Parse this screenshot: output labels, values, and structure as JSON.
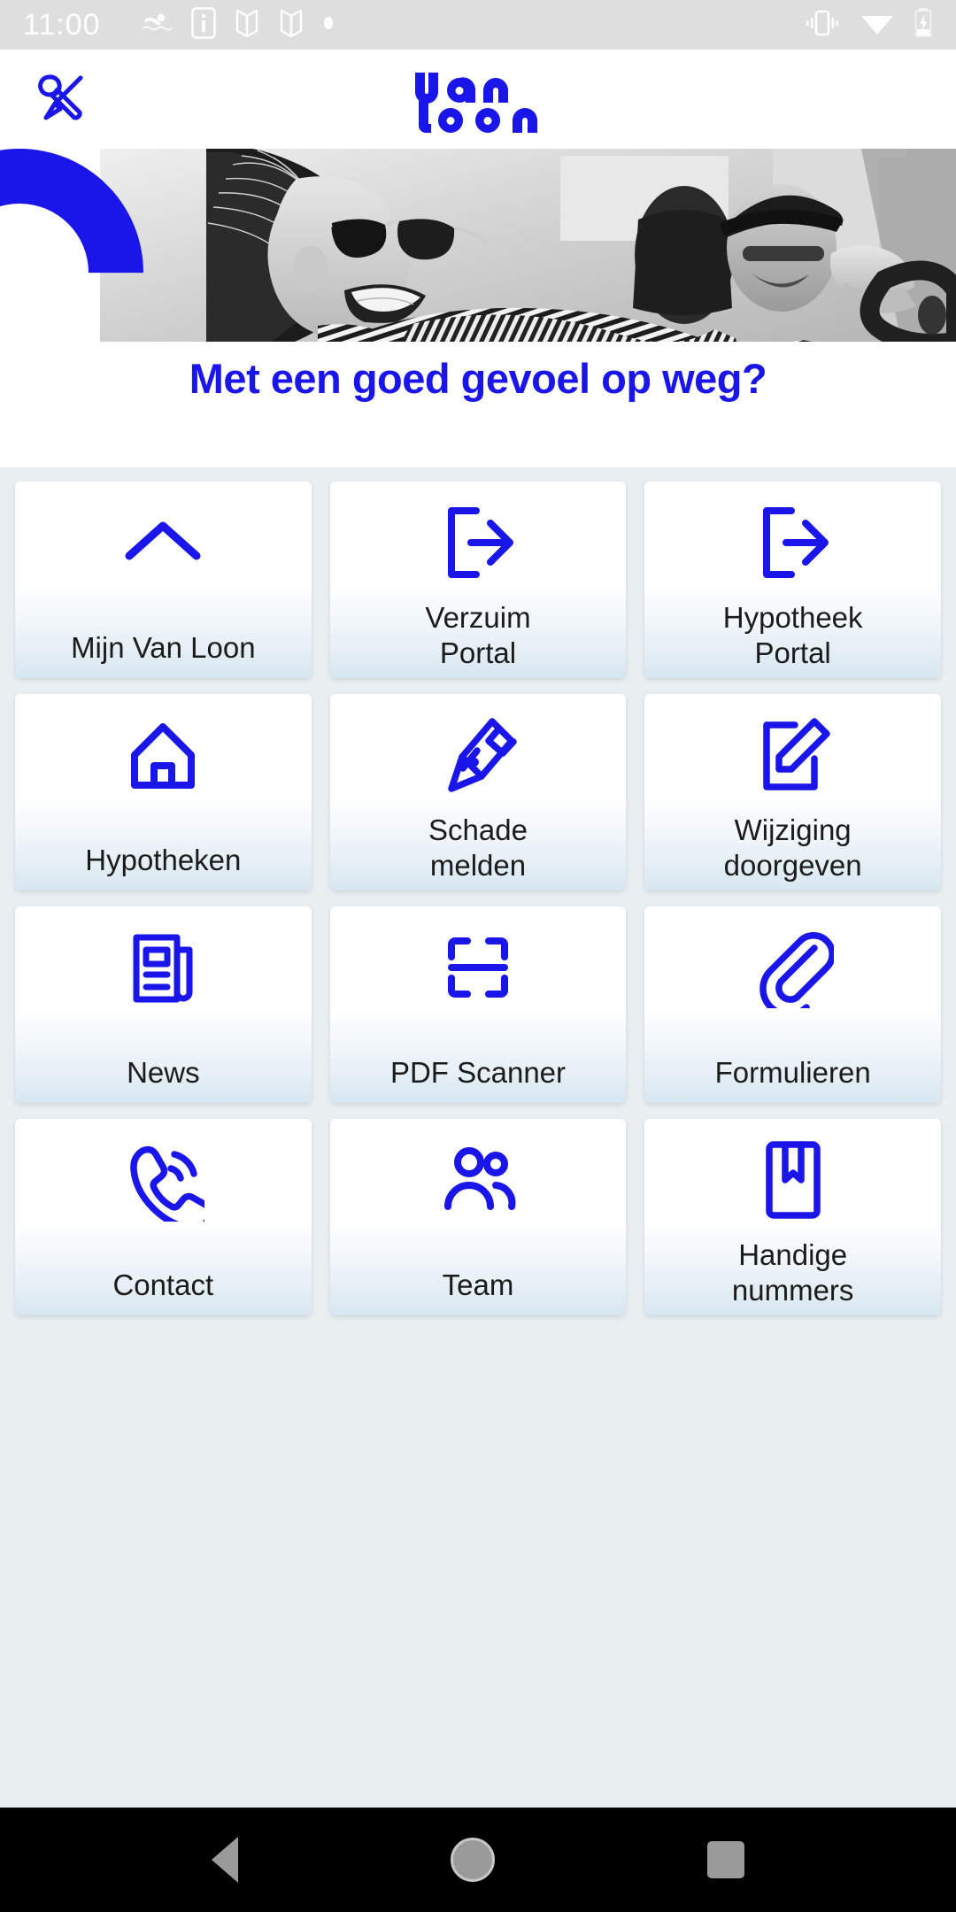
{
  "statusbar": {
    "time": "11:00",
    "left_icons": [
      "swimmer-icon",
      "info-icon",
      "book-icon",
      "book-icon",
      "dot-icon"
    ],
    "right_icons": [
      "vibrate-icon",
      "wifi-icon",
      "battery-charging-icon"
    ]
  },
  "header": {
    "tools_icon": "wrench-screwdriver-icon",
    "logo_line1": "van",
    "logo_line2": "loon",
    "logo_color": "#1a16ea"
  },
  "hero": {
    "image_alt": "two-women-driving-car-photo",
    "arc_color": "#1a16ea",
    "title": "Met een goed gevoel op weg?",
    "title_color": "#1a16ea"
  },
  "grid": {
    "tiles": [
      {
        "label": "Mijn Van Loon",
        "icon": "chevron-up-icon"
      },
      {
        "label": "Verzuim\nPortal",
        "icon": "external-link-icon"
      },
      {
        "label": "Hypotheek\nPortal",
        "icon": "external-link-icon"
      },
      {
        "label": "Hypotheken",
        "icon": "home-icon"
      },
      {
        "label": "Schade\nmelden",
        "icon": "fountain-pen-icon"
      },
      {
        "label": "Wijziging\ndoorgeven",
        "icon": "document-edit-icon"
      },
      {
        "label": "News",
        "icon": "newspaper-icon"
      },
      {
        "label": "PDF Scanner",
        "icon": "scan-frame-icon"
      },
      {
        "label": "Formulieren",
        "icon": "paperclip-icon"
      },
      {
        "label": "Contact",
        "icon": "phone-ringing-icon"
      },
      {
        "label": "Team",
        "icon": "people-icon"
      },
      {
        "label": "Handige\nnummers",
        "icon": "bookmark-book-icon"
      }
    ],
    "icon_color": "#1a16ea",
    "background": "#e9eef1"
  },
  "navbar": {
    "back_label": "back-button",
    "home_label": "home-button",
    "recent_label": "recent-apps-button"
  }
}
